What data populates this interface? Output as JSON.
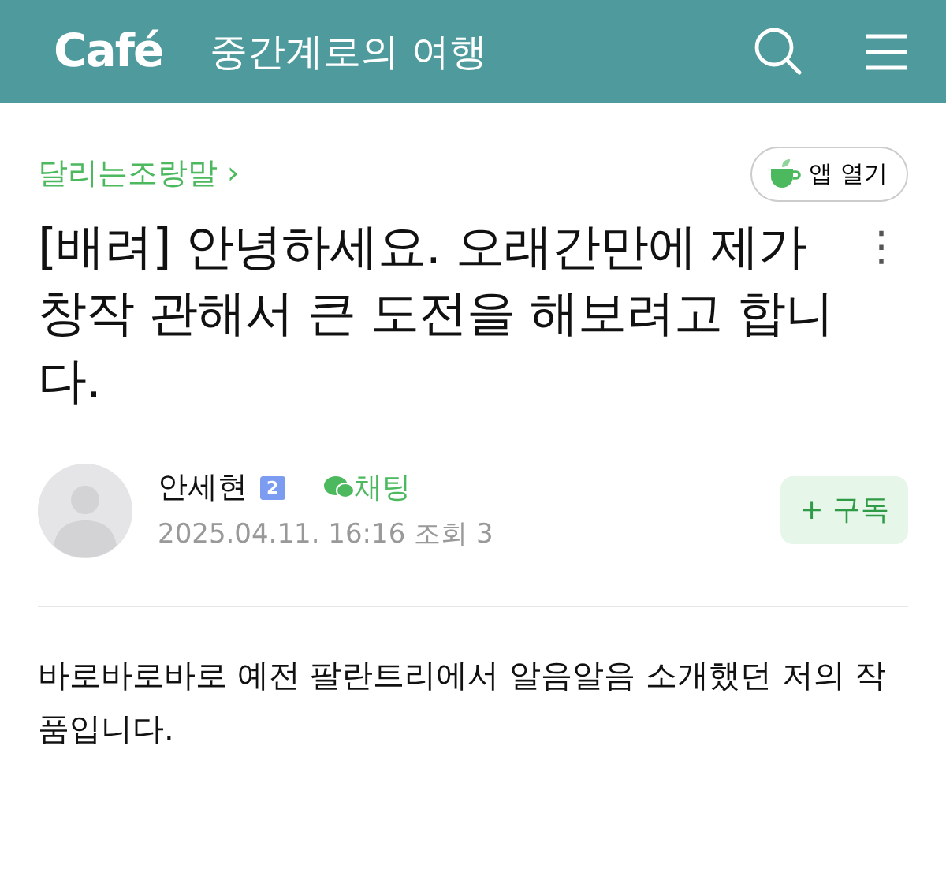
{
  "header": {
    "logo": "Café",
    "cafe_name": "중간계로의 여행"
  },
  "board": {
    "name": "달리는조랑말",
    "arrow": "›"
  },
  "app_button": {
    "label": "앱 열기"
  },
  "post": {
    "title": "[배려] 안녕하세요. 오래간만에 제가 창작 관해서 큰 도전을 해보려고 합니다.",
    "more": "⋮"
  },
  "author": {
    "name": "안세현",
    "level": "2",
    "chat": "채팅",
    "date": "2025.04.11. 16:16",
    "views": "조회 3",
    "subscribe_plus": "+",
    "subscribe": "구독"
  },
  "body": "바로바로바로 예전 팔란트리에서 알음알음 소개했던 저의 작품입니다."
}
